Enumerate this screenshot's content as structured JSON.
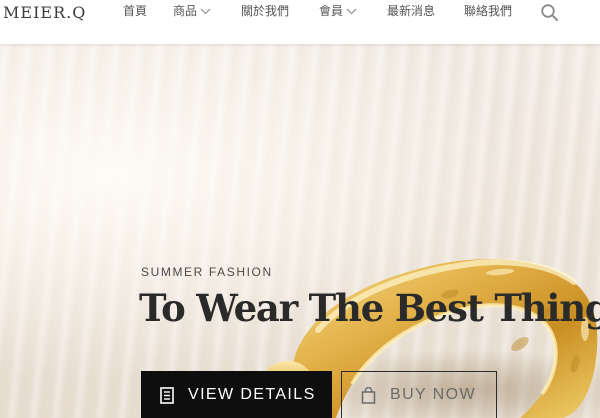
{
  "brand": {
    "logo": "MEIER.Q"
  },
  "nav": {
    "items": [
      {
        "label": "首頁"
      },
      {
        "label": "商品"
      },
      {
        "label": "關於我們"
      },
      {
        "label": "會員"
      },
      {
        "label": "最新消息"
      },
      {
        "label": "聯絡我們"
      }
    ],
    "search_icon": "search-icon",
    "dropdown_icon": "chevron-down-icon"
  },
  "hero": {
    "eyebrow": "SUMMER FASHION",
    "headline": "To Wear The Best Thing",
    "primary_button": "VIEW DETAILS",
    "primary_icon": "document-list-icon",
    "secondary_button": "BUY NOW",
    "secondary_icon": "shopping-bag-icon",
    "image_subject": "gold-hoop-earring"
  },
  "colors": {
    "text_dark": "#2a2a2a",
    "nav_text": "#555555",
    "button_primary_bg": "#0e0e0e",
    "button_primary_text": "#ffffff",
    "gold": "#d8a53a",
    "background": "#efe8df"
  }
}
